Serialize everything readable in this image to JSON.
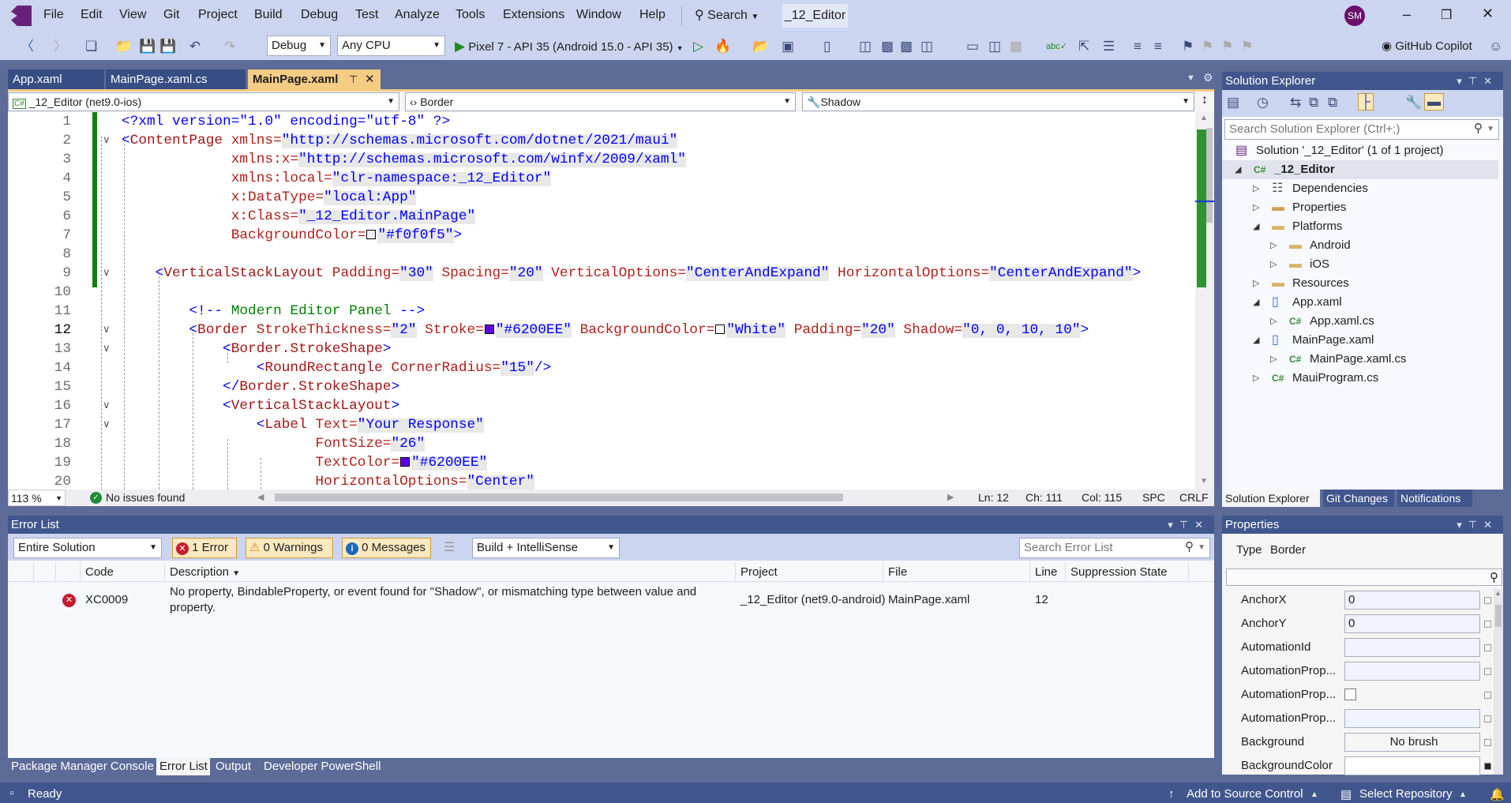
{
  "titlebar": {
    "menus": [
      "File",
      "Edit",
      "View",
      "Git",
      "Project",
      "Build",
      "Debug",
      "Test",
      "Analyze",
      "Tools",
      "Extensions",
      "Window",
      "Help"
    ],
    "search_label": "Search",
    "solution_name": "_12_Editor",
    "avatar_initials": "SM"
  },
  "toolbar": {
    "configuration": "Debug",
    "platform": "Any CPU",
    "run_target": "Pixel 7 - API 35 (Android 15.0 - API 35)",
    "copilot_label": "GitHub Copilot"
  },
  "doc_tabs": [
    {
      "label": "App.xaml",
      "active": false
    },
    {
      "label": "MainPage.xaml.cs",
      "active": false
    },
    {
      "label": "MainPage.xaml",
      "active": true
    }
  ],
  "navbar": {
    "project": "_12_Editor (net9.0-ios)",
    "element": "Border",
    "member": "Shadow"
  },
  "editor": {
    "current_line": 12,
    "colors": {
      "delimiter": "#0000ff",
      "element": "#a31515",
      "attribute": "#b0201a",
      "value": "#0000ff",
      "comment": "#008000"
    },
    "fold_lines": [
      2,
      9,
      12,
      13,
      16,
      17
    ],
    "lines": [
      [
        [
          "d",
          "<?xml version=\"1.0\" encoding=\"utf-8\" ?>"
        ]
      ],
      [
        [
          "d",
          "<"
        ],
        [
          "e",
          "ContentPage"
        ],
        [
          "a",
          " xmlns="
        ],
        [
          "v",
          "\"http://schemas.microsoft.com/dotnet/2021/maui\""
        ]
      ],
      [
        [
          "a",
          "             xmlns:x="
        ],
        [
          "v",
          "\"http://schemas.microsoft.com/winfx/2009/xaml\""
        ]
      ],
      [
        [
          "a",
          "             xmlns:local="
        ],
        [
          "v",
          "\"clr-namespace:_12_Editor\""
        ]
      ],
      [
        [
          "a",
          "             x:DataType="
        ],
        [
          "v",
          "\"local:App\""
        ]
      ],
      [
        [
          "a",
          "             x:Class="
        ],
        [
          "v",
          "\"_12_Editor.MainPage\""
        ]
      ],
      [
        [
          "a",
          "             BackgroundColor="
        ],
        [
          "s",
          "#f0f0f5"
        ],
        [
          "v",
          "\"#f0f0f5\""
        ],
        [
          "d",
          ">"
        ]
      ],
      [],
      [
        [
          "d",
          "    <"
        ],
        [
          "e",
          "VerticalStackLayout"
        ],
        [
          "a",
          " Padding="
        ],
        [
          "v",
          "\"30\""
        ],
        [
          "a",
          " Spacing="
        ],
        [
          "v",
          "\"20\""
        ],
        [
          "a",
          " VerticalOptions="
        ],
        [
          "v",
          "\"CenterAndExpand\""
        ],
        [
          "a",
          " HorizontalOptions="
        ],
        [
          "v",
          "\"CenterAndExpand\""
        ],
        [
          "d",
          ">"
        ]
      ],
      [],
      [
        [
          "d",
          "        <!--"
        ],
        [
          "c",
          " Modern Editor Panel "
        ],
        [
          "d",
          "-->"
        ]
      ],
      [
        [
          "d",
          "        <"
        ],
        [
          "e",
          "Border"
        ],
        [
          "a",
          " StrokeThickness="
        ],
        [
          "v",
          "\"2\""
        ],
        [
          "a",
          " Stroke="
        ],
        [
          "s",
          "#6200EE"
        ],
        [
          "v",
          "\"#6200EE\""
        ],
        [
          "a",
          " BackgroundColor="
        ],
        [
          "s",
          "#ffffff"
        ],
        [
          "v",
          "\"White\""
        ],
        [
          "a",
          " Padding="
        ],
        [
          "v",
          "\"20\""
        ],
        [
          "a",
          " Shadow="
        ],
        [
          "v",
          "\"0, 0, 10, 10\""
        ],
        [
          "d",
          ">"
        ]
      ],
      [
        [
          "d",
          "            <"
        ],
        [
          "e",
          "Border.StrokeShape"
        ],
        [
          "d",
          ">"
        ]
      ],
      [
        [
          "d",
          "                <"
        ],
        [
          "e",
          "RoundRectangle"
        ],
        [
          "a",
          " CornerRadius="
        ],
        [
          "v",
          "\"15\""
        ],
        [
          "d",
          "/>"
        ]
      ],
      [
        [
          "d",
          "            </"
        ],
        [
          "e",
          "Border.StrokeShape"
        ],
        [
          "d",
          ">"
        ]
      ],
      [
        [
          "d",
          "            <"
        ],
        [
          "e",
          "VerticalStackLayout"
        ],
        [
          "d",
          ">"
        ]
      ],
      [
        [
          "d",
          "                <"
        ],
        [
          "e",
          "Label"
        ],
        [
          "a",
          " Text="
        ],
        [
          "v",
          "\"Your Response\""
        ]
      ],
      [
        [
          "a",
          "                       FontSize="
        ],
        [
          "v",
          "\"26\""
        ]
      ],
      [
        [
          "a",
          "                       TextColor="
        ],
        [
          "s",
          "#6200EE"
        ],
        [
          "v",
          "\"#6200EE\""
        ]
      ],
      [
        [
          "a",
          "                       HorizontalOptions="
        ],
        [
          "v",
          "\"Center\""
        ]
      ]
    ]
  },
  "editor_status": {
    "zoom": "113 %",
    "issues": "No issues found",
    "ln": "Ln: 12",
    "ch": "Ch: 111",
    "col": "Col: 115",
    "whitespace": "SPC",
    "line_ending": "CRLF"
  },
  "error_list": {
    "title": "Error List",
    "scope": "Entire Solution",
    "errors_btn": "1 Error",
    "warnings_btn": "0 Warnings",
    "messages_btn": "0 Messages",
    "source": "Build + IntelliSense",
    "search_placeholder": "Search Error List",
    "columns": [
      "Code",
      "Description",
      "Project",
      "File",
      "Line",
      "Suppression State"
    ],
    "rows": [
      {
        "severity": "error",
        "code": "XC0009",
        "description_1": "No property, BindableProperty, or event found for \"Shadow\", or mismatching type between value and",
        "description_2": "property.",
        "project": "_12_Editor (net9.0-android)",
        "file": "MainPage.xaml",
        "line": "12",
        "suppression": ""
      }
    ]
  },
  "bottom_tabs": [
    {
      "label": "Package Manager Console",
      "active": false
    },
    {
      "label": "Error List",
      "active": true
    },
    {
      "label": "Output",
      "active": false
    },
    {
      "label": "Developer PowerShell",
      "active": false
    }
  ],
  "solution_explorer": {
    "title": "Solution Explorer",
    "search_placeholder": "Search Solution Explorer (Ctrl+;)",
    "items": [
      {
        "label": "Solution '_12_Editor' (1 of 1 project)",
        "level": 0,
        "expander": "",
        "icon": "solution-icon"
      },
      {
        "label": "_12_Editor",
        "level": 1,
        "expander": "expanded",
        "icon": "csharp-project-icon",
        "selected": true
      },
      {
        "label": "Dependencies",
        "level": 2,
        "expander": "collapsed",
        "icon": "dependencies-icon"
      },
      {
        "label": "Properties",
        "level": 2,
        "expander": "collapsed",
        "icon": "properties-folder-icon"
      },
      {
        "label": "Platforms",
        "level": 2,
        "expander": "expanded",
        "icon": "folder-icon"
      },
      {
        "label": "Android",
        "level": 3,
        "expander": "collapsed",
        "icon": "folder-icon"
      },
      {
        "label": "iOS",
        "level": 3,
        "expander": "collapsed",
        "icon": "folder-icon"
      },
      {
        "label": "Resources",
        "level": 2,
        "expander": "collapsed",
        "icon": "folder-icon"
      },
      {
        "label": "App.xaml",
        "level": 2,
        "expander": "expanded",
        "icon": "xaml-file-icon"
      },
      {
        "label": "App.xaml.cs",
        "level": 3,
        "expander": "collapsed",
        "icon": "csharp-file-icon"
      },
      {
        "label": "MainPage.xaml",
        "level": 2,
        "expander": "expanded",
        "icon": "xaml-file-icon"
      },
      {
        "label": "MainPage.xaml.cs",
        "level": 3,
        "expander": "collapsed",
        "icon": "csharp-file-icon"
      },
      {
        "label": "MauiProgram.cs",
        "level": 2,
        "expander": "collapsed",
        "icon": "csharp-file-icon"
      }
    ],
    "tabs": [
      {
        "label": "Solution Explorer",
        "active": true
      },
      {
        "label": "Git Changes",
        "active": false
      },
      {
        "label": "Notifications",
        "active": false
      }
    ]
  },
  "properties": {
    "title": "Properties",
    "type_label": "Type",
    "type_value": "Border",
    "rows": [
      {
        "name": "AnchorX",
        "value": "0",
        "kind": "text"
      },
      {
        "name": "AnchorY",
        "value": "0",
        "kind": "text"
      },
      {
        "name": "AutomationId",
        "value": "",
        "kind": "text"
      },
      {
        "name": "AutomationProp...",
        "value": "",
        "kind": "text"
      },
      {
        "name": "AutomationProp...",
        "value": "",
        "kind": "checkbox"
      },
      {
        "name": "AutomationProp...",
        "value": "",
        "kind": "text"
      },
      {
        "name": "Background",
        "value": "No brush",
        "kind": "brush"
      },
      {
        "name": "BackgroundColor",
        "value": "",
        "kind": "color"
      }
    ]
  },
  "statusbar": {
    "ready": "Ready",
    "source_control": "Add to Source Control",
    "repository": "Select Repository"
  }
}
